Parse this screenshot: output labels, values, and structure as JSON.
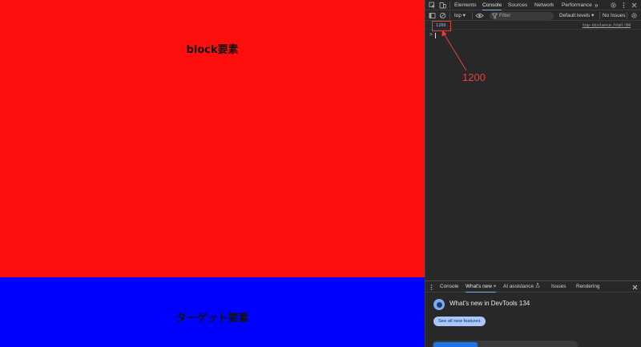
{
  "page": {
    "block_label": "block要素",
    "target_label": "ターゲット要素"
  },
  "devtools": {
    "tabs": [
      "Elements",
      "Console",
      "Sources",
      "Network",
      "Performance"
    ],
    "active_tab": "Console",
    "more_tabs_glyph": "»",
    "console_bar": {
      "context": "top ▾",
      "filter_placeholder": "Filter",
      "levels": "Default levels ▾",
      "issues": "No Issues"
    },
    "log": {
      "value": "1200",
      "source": "top-distance.html:84",
      "prompt_glyph": ">"
    },
    "drawer": {
      "tabs": [
        "Console",
        "What's new",
        "AI assistance",
        "Issues",
        "Rendering"
      ],
      "active_tab": "What's new",
      "close_glyph": "×",
      "whats_new_title": "What's new in DevTools 134",
      "see_all_label": "See all new features"
    }
  },
  "annotation": {
    "text": "1200",
    "color": "#e8403a"
  },
  "colors": {
    "block": "#ff0e0e",
    "target": "#0000ff",
    "devtools_bg": "#282828",
    "accent": "#7cacf8"
  }
}
